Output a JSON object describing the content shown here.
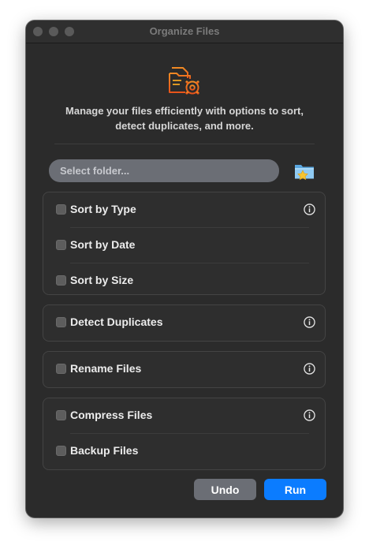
{
  "window": {
    "title": "Organize Files"
  },
  "header": {
    "icon": "folder-gear-icon",
    "description": "Manage your files efficiently with options to sort, detect duplicates, and more."
  },
  "folder_picker": {
    "placeholder": "Select folder...",
    "value": "",
    "button_icon": "folder-star-icon"
  },
  "groups": [
    {
      "options": [
        {
          "label": "Sort by Type",
          "checked": false,
          "info": true
        },
        {
          "label": "Sort by Date",
          "checked": false,
          "info": false
        },
        {
          "label": "Sort by Size",
          "checked": false,
          "info": false
        }
      ]
    },
    {
      "options": [
        {
          "label": "Detect Duplicates",
          "checked": false,
          "info": true
        }
      ]
    },
    {
      "options": [
        {
          "label": "Rename Files",
          "checked": false,
          "info": true
        }
      ]
    },
    {
      "options": [
        {
          "label": "Compress Files",
          "checked": false,
          "info": true
        },
        {
          "label": "Backup Files",
          "checked": false,
          "info": false
        }
      ]
    }
  ],
  "actions": {
    "undo_label": "Undo",
    "run_label": "Run"
  },
  "colors": {
    "accent": "#0b7cff",
    "icon_orange": "#f06a1f",
    "icon_yellow": "#f5a623",
    "window_bg": "#2b2b2b"
  }
}
